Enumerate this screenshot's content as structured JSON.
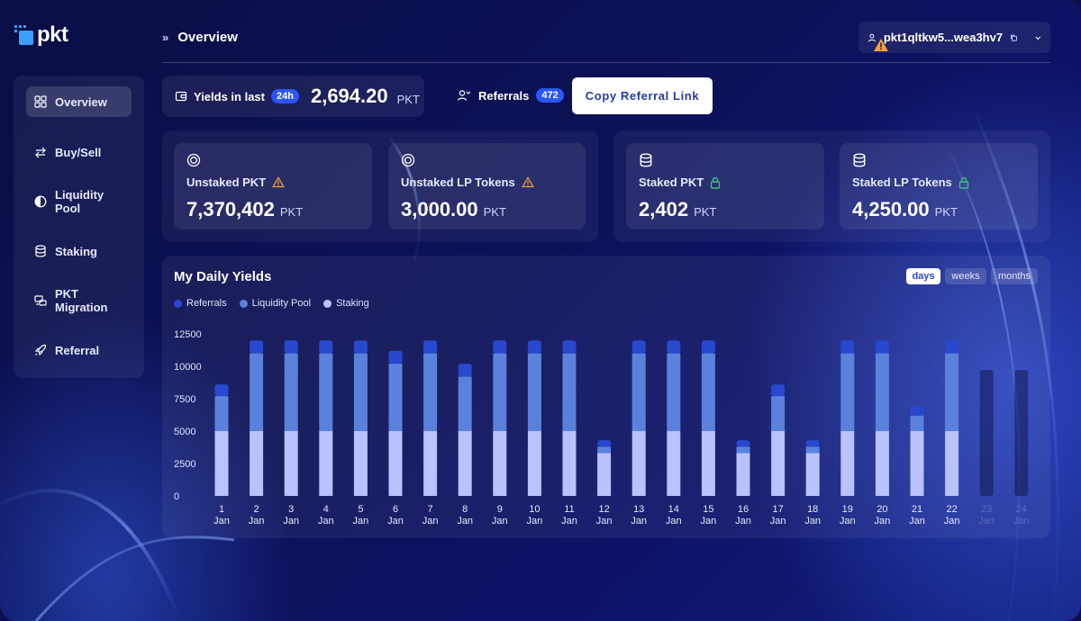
{
  "app": {
    "logo_text": "pkt"
  },
  "header": {
    "breadcrumb": "Overview",
    "wallet_address": "pkt1qltkw5...wea3hv7"
  },
  "sidebar": {
    "items": [
      {
        "label": "Overview",
        "icon": "grid-icon",
        "active": true
      },
      {
        "label": "Buy/Sell",
        "icon": "swap-arrows-icon"
      },
      {
        "label": "Liquidity Pool",
        "icon": "half-circle-icon"
      },
      {
        "label": "Staking",
        "icon": "database-icon"
      },
      {
        "label": "PKT Migration",
        "icon": "migration-icon"
      },
      {
        "label": "Referral",
        "icon": "rocket-icon"
      }
    ]
  },
  "yields": {
    "label": "Yields in last",
    "period_badge": "24h",
    "value": "2,694.20",
    "unit": "PKT"
  },
  "referrals": {
    "label": "Referrals",
    "count": "472",
    "copy_button": "Copy Referral Link"
  },
  "stats": {
    "unstaked_pkt": {
      "title": "Unstaked PKT",
      "value": "7,370,402",
      "unit": "PKT",
      "status_icon": "warning-icon"
    },
    "unstaked_lp": {
      "title": "Unstaked LP Tokens",
      "value": "3,000.00",
      "unit": "PKT",
      "status_icon": "warning-icon"
    },
    "staked_pkt": {
      "title": "Staked PKT",
      "value": "2,402",
      "unit": "PKT",
      "status_icon": "lock-icon"
    },
    "staked_lp": {
      "title": "Staked LP Tokens",
      "value": "4,250.00",
      "unit": "PKT",
      "status_icon": "lock-icon"
    }
  },
  "colors": {
    "accent": "#2a56ff",
    "warning": "#f2a13a",
    "lock": "#37c47a",
    "series_referrals": "#2848d0",
    "series_liquidity": "#5a82dc",
    "series_staking": "#b9c3ff"
  },
  "chart_panel": {
    "title": "My Daily Yields",
    "toggles": [
      {
        "label": "days",
        "active": true
      },
      {
        "label": "weeks"
      },
      {
        "label": "months"
      }
    ]
  },
  "chart_data": {
    "type": "bar",
    "stacked": true,
    "title": "My Daily Yields",
    "categories": [
      "1 Jan",
      "2 Jan",
      "3 Jan",
      "4 Jan",
      "5 Jan",
      "6 Jan",
      "7 Jan",
      "8 Jan",
      "9 Jan",
      "10 Jan",
      "11 Jan",
      "12 Jan",
      "13 Jan",
      "14 Jan",
      "15 Jan",
      "16 Jan",
      "17 Jan",
      "18 Jan",
      "19 Jan",
      "20 Jan",
      "21 Jan",
      "22 Jan",
      "23 Jan",
      "24 Jan"
    ],
    "series": [
      {
        "name": "Staking",
        "values": [
          5000,
          5000,
          5000,
          5000,
          5000,
          5000,
          5000,
          5000,
          5000,
          5000,
          5000,
          3300,
          5000,
          5000,
          5000,
          3300,
          5000,
          3300,
          5000,
          5000,
          5000,
          5000,
          null,
          null
        ]
      },
      {
        "name": "Liquidity Pool",
        "values": [
          2700,
          6000,
          6000,
          6000,
          6000,
          5200,
          6000,
          4200,
          6000,
          6000,
          6000,
          500,
          6000,
          6000,
          6000,
          500,
          2700,
          500,
          6000,
          6000,
          1200,
          6000,
          null,
          null
        ]
      },
      {
        "name": "Referrals",
        "values": [
          900,
          1000,
          1000,
          1000,
          1000,
          1000,
          1000,
          1000,
          1000,
          1000,
          1000,
          500,
          1000,
          1000,
          1000,
          500,
          900,
          500,
          1000,
          1000,
          700,
          1000,
          null,
          null
        ]
      }
    ],
    "legend": [
      "Referrals",
      "Liquidity Pool",
      "Staking"
    ],
    "y_ticks": [
      "0",
      "2500",
      "5000",
      "7500",
      "10000",
      "12500"
    ],
    "ylim": [
      0,
      12500
    ],
    "grid": false,
    "legend_position": "top-left"
  }
}
